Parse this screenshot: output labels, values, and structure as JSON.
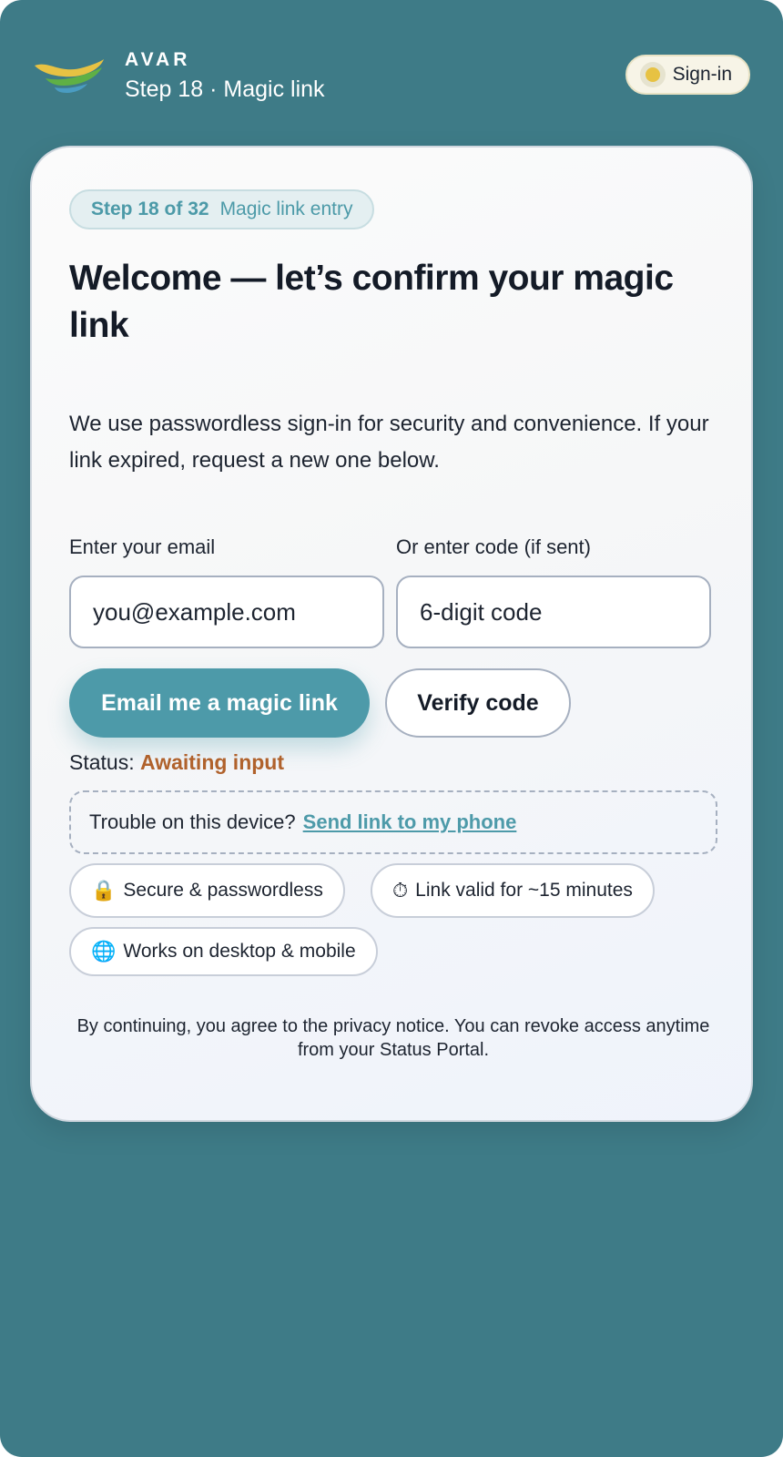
{
  "header": {
    "brand": "AVAR",
    "subtitle": "Step 18 · Magic link",
    "signin_label": "Sign-in"
  },
  "card": {
    "step_chip_strong": "Step 18 of 32",
    "step_chip_text": "Magic link entry",
    "title": "Welcome — let’s confirm your magic link",
    "intro": "We use passwordless sign-in for security and convenience. If your link expired, request a new one below.",
    "email": {
      "label": "Enter your email",
      "placeholder": "you@example.com",
      "value": ""
    },
    "code": {
      "label": "Or enter code (if sent)",
      "placeholder": "6-digit code",
      "value": ""
    },
    "primary_button": "Email me a magic link",
    "secondary_button": "Verify code",
    "status_label": "Status:",
    "status_value": "Awaiting input",
    "trouble_text": "Trouble on this device?",
    "trouble_link": "Send link to my phone",
    "badges": [
      {
        "icon": "lock-icon",
        "glyph": "🔒",
        "label": "Secure & passwordless"
      },
      {
        "icon": "stopwatch-icon",
        "glyph": "⏱",
        "label": "Link valid for ~15 minutes"
      },
      {
        "icon": "globe-icon",
        "glyph": "🌐",
        "label": "Works on desktop & mobile"
      }
    ],
    "legal": "By continuing, you agree to the privacy notice. You can revoke access anytime from your Status Portal."
  },
  "colors": {
    "background": "#3e7b87",
    "accent": "#4d9aa9",
    "status_warning": "#b0622c",
    "logo_yellow": "#e7c243",
    "logo_green": "#5fb045",
    "logo_blue": "#4a9cc2"
  }
}
